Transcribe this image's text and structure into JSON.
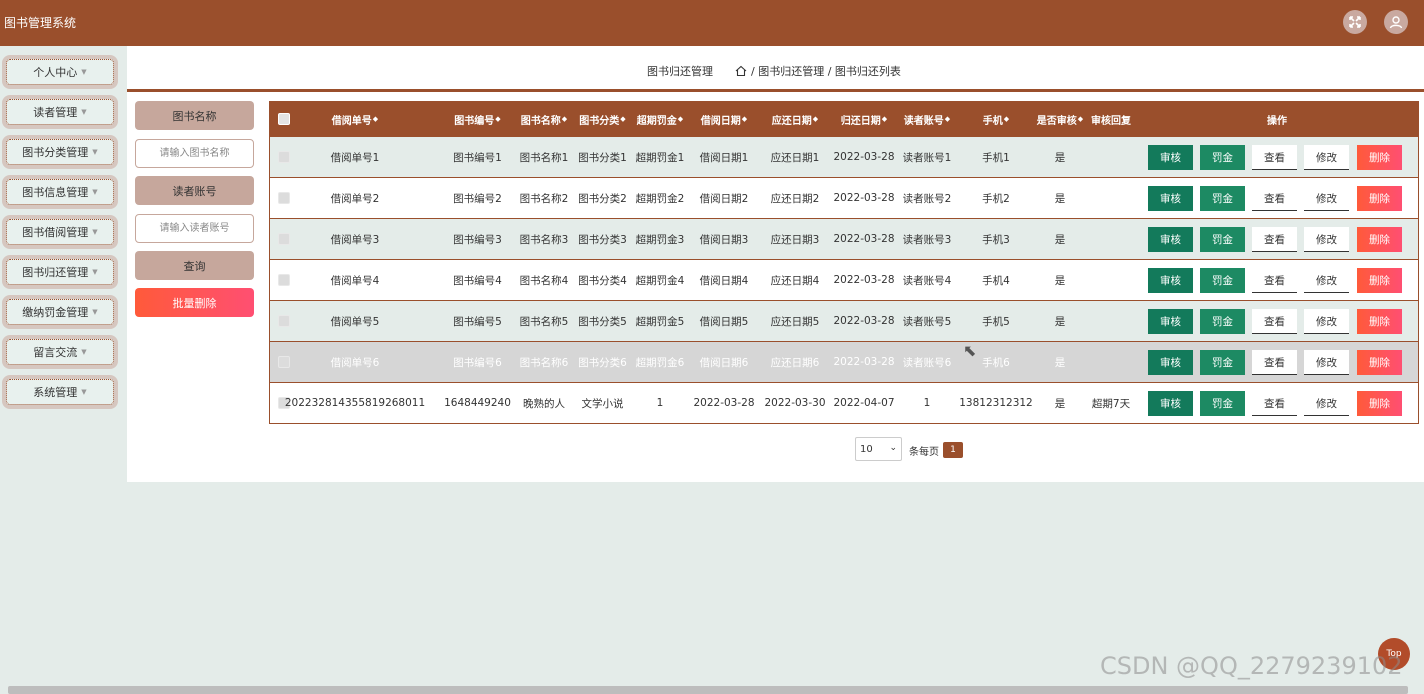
{
  "app": {
    "title": "图书管理系统"
  },
  "sidebar": {
    "items": [
      {
        "label": "个人中心"
      },
      {
        "label": "读者管理"
      },
      {
        "label": "图书分类管理"
      },
      {
        "label": "图书信息管理"
      },
      {
        "label": "图书借阅管理"
      },
      {
        "label": "图书归还管理"
      },
      {
        "label": "缴纳罚金管理"
      },
      {
        "label": "留言交流"
      },
      {
        "label": "系统管理"
      }
    ]
  },
  "header": {
    "page_title": "图书归还管理",
    "breadcrumb": "/ 图书归还管理 / 图书归还列表"
  },
  "search": {
    "book_name_label": "图书名称",
    "book_name_placeholder": "请输入图书名称",
    "reader_label": "读者账号",
    "reader_placeholder": "请输入读者账号",
    "query_label": "查询",
    "batch_delete_label": "批量删除"
  },
  "table": {
    "columns": [
      "借阅单号",
      "图书编号",
      "图书名称",
      "图书分类",
      "超期罚金",
      "借阅日期",
      "应还日期",
      "归还日期",
      "读者账号",
      "手机",
      "是否审核",
      "审核回复",
      "操作"
    ],
    "actions": {
      "review": "审核",
      "fine": "罚金",
      "view": "查看",
      "edit": "修改",
      "delete": "删除"
    },
    "rows": [
      {
        "borrow_no": "借阅单号1",
        "book_no": "图书编号1",
        "book_name": "图书名称1",
        "category": "图书分类1",
        "fine": "超期罚金1",
        "borrow_date": "借阅日期1",
        "due_date": "应还日期1",
        "return_date": "2022-03-28",
        "reader": "读者账号1",
        "phone": "手机1",
        "reviewed": "是",
        "reply": ""
      },
      {
        "borrow_no": "借阅单号2",
        "book_no": "图书编号2",
        "book_name": "图书名称2",
        "category": "图书分类2",
        "fine": "超期罚金2",
        "borrow_date": "借阅日期2",
        "due_date": "应还日期2",
        "return_date": "2022-03-28",
        "reader": "读者账号2",
        "phone": "手机2",
        "reviewed": "是",
        "reply": ""
      },
      {
        "borrow_no": "借阅单号3",
        "book_no": "图书编号3",
        "book_name": "图书名称3",
        "category": "图书分类3",
        "fine": "超期罚金3",
        "borrow_date": "借阅日期3",
        "due_date": "应还日期3",
        "return_date": "2022-03-28",
        "reader": "读者账号3",
        "phone": "手机3",
        "reviewed": "是",
        "reply": ""
      },
      {
        "borrow_no": "借阅单号4",
        "book_no": "图书编号4",
        "book_name": "图书名称4",
        "category": "图书分类4",
        "fine": "超期罚金4",
        "borrow_date": "借阅日期4",
        "due_date": "应还日期4",
        "return_date": "2022-03-28",
        "reader": "读者账号4",
        "phone": "手机4",
        "reviewed": "是",
        "reply": ""
      },
      {
        "borrow_no": "借阅单号5",
        "book_no": "图书编号5",
        "book_name": "图书名称5",
        "category": "图书分类5",
        "fine": "超期罚金5",
        "borrow_date": "借阅日期5",
        "due_date": "应还日期5",
        "return_date": "2022-03-28",
        "reader": "读者账号5",
        "phone": "手机5",
        "reviewed": "是",
        "reply": ""
      },
      {
        "borrow_no": "借阅单号6",
        "book_no": "图书编号6",
        "book_name": "图书名称6",
        "category": "图书分类6",
        "fine": "超期罚金6",
        "borrow_date": "借阅日期6",
        "due_date": "应还日期6",
        "return_date": "2022-03-28",
        "reader": "读者账号6",
        "phone": "手机6",
        "reviewed": "是",
        "reply": ""
      },
      {
        "borrow_no": "2022328143558192680​11",
        "book_no": "1648449240",
        "book_name": "晚熟的人",
        "category": "文学小说",
        "fine": "1",
        "borrow_date": "2022-03-28",
        "due_date": "2022-03-30",
        "return_date": "2022-04-07",
        "reader": "1",
        "phone": "13812312312",
        "reviewed": "是",
        "reply": "超期7天"
      }
    ]
  },
  "pagination": {
    "page_size": "10",
    "unit_label": "条每页",
    "current_page": "1"
  },
  "misc": {
    "top_label": "Top",
    "watermark": "CSDN @QQ_2279239102"
  }
}
